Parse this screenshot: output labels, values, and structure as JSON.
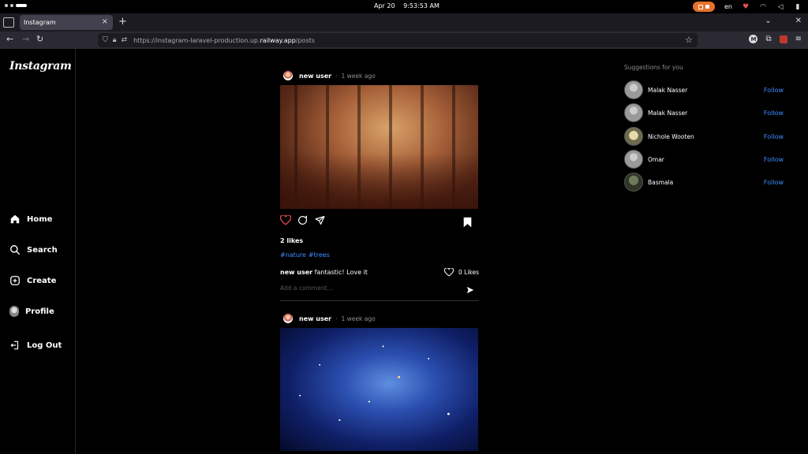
{
  "os": {
    "date": "Apr 20",
    "time": "9:53:53 AM",
    "lang": "en"
  },
  "browser": {
    "tab_title": "Instagram",
    "url_prefix": "https://instagram-laravel-production.up.",
    "url_domain": "railway.app",
    "url_path": "/posts",
    "ext_label": "M"
  },
  "sidebar": {
    "logo": "Instagram",
    "items": [
      {
        "label": "Home",
        "icon": "home-icon"
      },
      {
        "label": "Search",
        "icon": "search-icon"
      },
      {
        "label": "Create",
        "icon": "plus-square-icon"
      },
      {
        "label": "Profile",
        "icon": "avatar"
      },
      {
        "label": "Log Out",
        "icon": "logout-icon"
      }
    ]
  },
  "posts": [
    {
      "user": "new user",
      "time": "1 week ago",
      "image": "autumn-trees",
      "likes": "2 likes",
      "tags": [
        "#nature",
        "#trees"
      ],
      "comment_user": "new user",
      "comment_text": "fantastic! Love it",
      "comment_likes": "0 Likes",
      "comment_placeholder": "Add a comment..."
    },
    {
      "user": "new user",
      "time": "1 week ago",
      "image": "galaxy"
    }
  ],
  "suggestions": {
    "title": "Suggestions for you",
    "follow_label": "Follow",
    "users": [
      {
        "name": "Malak Nasser"
      },
      {
        "name": "Malak Nasser"
      },
      {
        "name": "Nichole Wooten"
      },
      {
        "name": "Omar"
      },
      {
        "name": "Basmala"
      }
    ]
  },
  "colors": {
    "accent": "#3f8cff",
    "like": "#ed4956",
    "background": "#000000"
  }
}
